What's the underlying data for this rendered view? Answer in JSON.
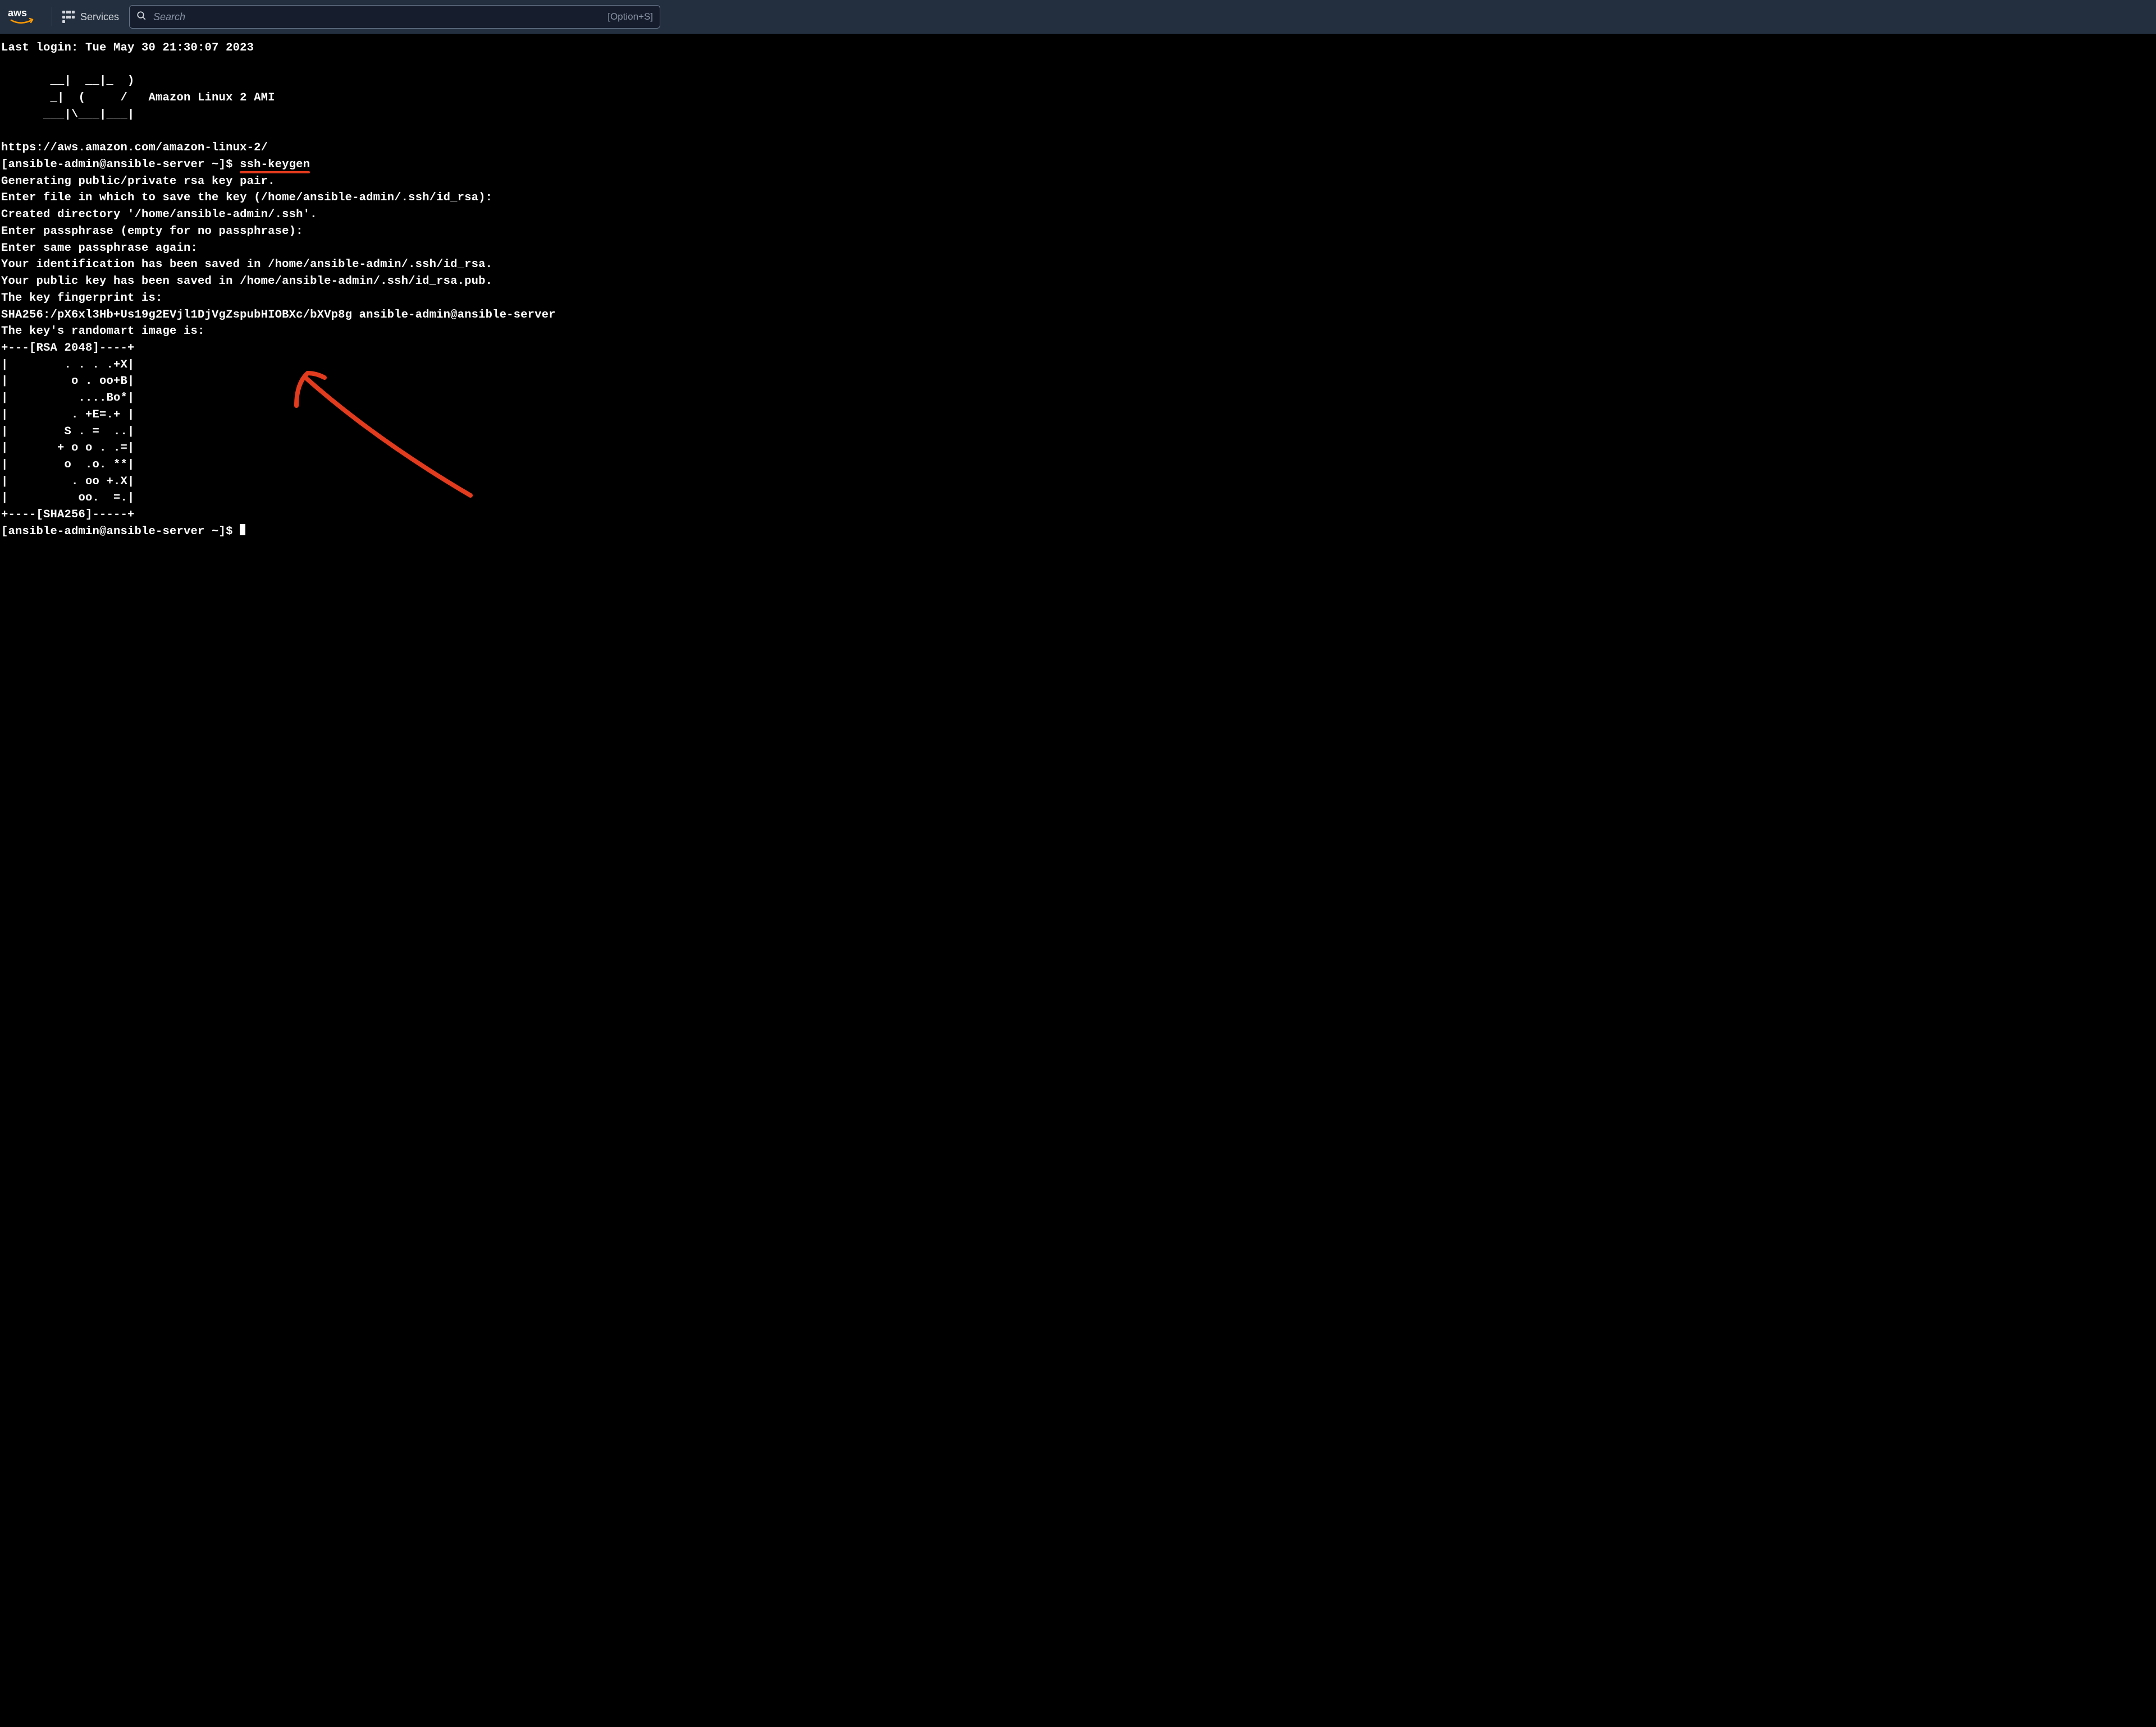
{
  "nav": {
    "services_label": "Services",
    "search_placeholder": "Search",
    "search_shortcut": "[Option+S]"
  },
  "terminal": {
    "last_login": "Last login: Tue May 30 21:30:07 2023",
    "banner_l1": "       __|  __|_  )",
    "banner_l2": "       _|  (     /   Amazon Linux 2 AMI",
    "banner_l3": "      ___|\\___|___|",
    "url": "https://aws.amazon.com/amazon-linux-2/",
    "prompt1_prefix": "[ansible-admin@ansible-server ~]$ ",
    "prompt1_cmd": "ssh-keygen",
    "out_generating": "Generating public/private rsa key pair.",
    "out_enter_file": "Enter file in which to save the key (/home/ansible-admin/.ssh/id_rsa):",
    "out_created_dir": "Created directory '/home/ansible-admin/.ssh'.",
    "out_enter_pass": "Enter passphrase (empty for no passphrase):",
    "out_enter_pass2": "Enter same passphrase again:",
    "out_id_saved": "Your identification has been saved in /home/ansible-admin/.ssh/id_rsa.",
    "out_pub_saved": "Your public key has been saved in /home/ansible-admin/.ssh/id_rsa.pub.",
    "out_fp_is": "The key fingerprint is:",
    "out_fp": "SHA256:/pX6xl3Hb+Us19g2EVjl1DjVgZspubHIOBXc/bXVp8g ansible-admin@ansible-server",
    "out_randomart": "The key's randomart image is:",
    "art_l0": "+---[RSA 2048]----+",
    "art_l1": "|        . . . .+X|",
    "art_l2": "|         o . oo+B|",
    "art_l3": "|          ....Bo*|",
    "art_l4": "|         . +E=.+ |",
    "art_l5": "|        S . =  ..|",
    "art_l6": "|       + o o . .=|",
    "art_l7": "|        o  .o. **|",
    "art_l8": "|         . oo +.X|",
    "art_l9": "|          oo.  =.|",
    "art_l10": "+----[SHA256]-----+",
    "prompt2": "[ansible-admin@ansible-server ~]$ "
  }
}
